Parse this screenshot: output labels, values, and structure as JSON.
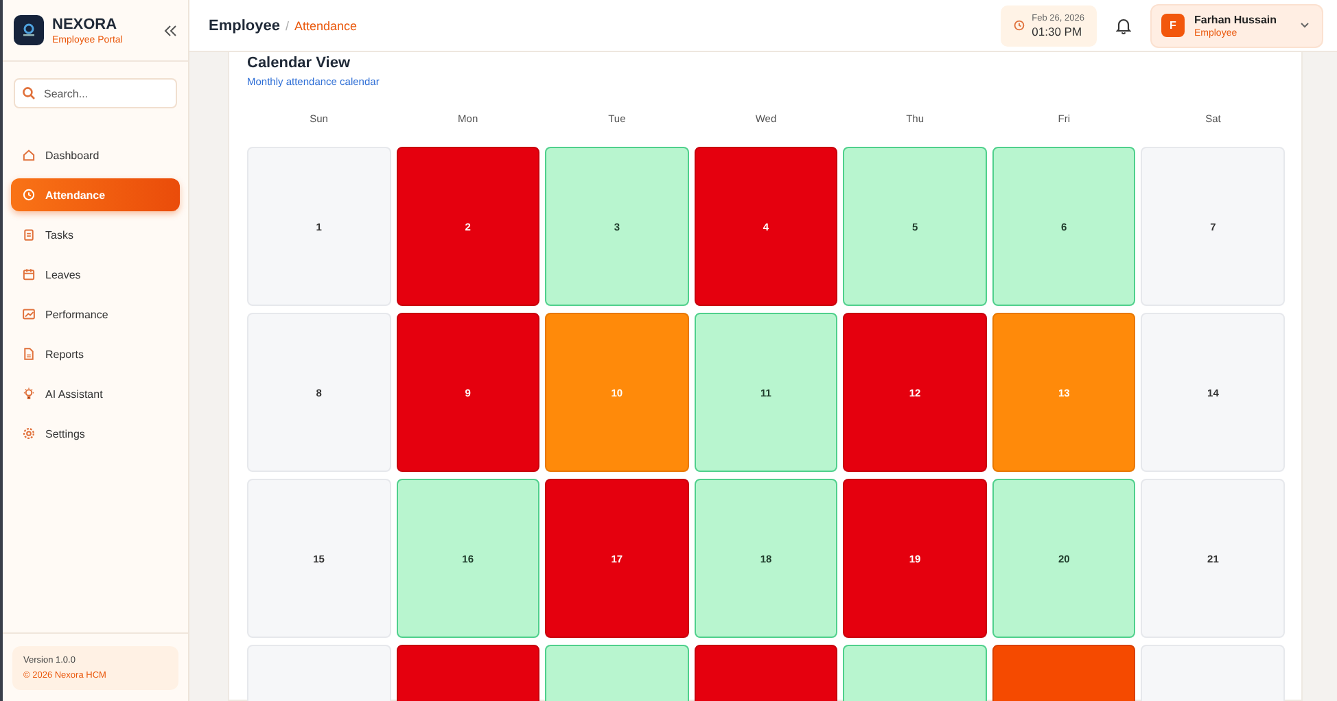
{
  "sidebar": {
    "brand": {
      "name": "NEXORA",
      "subtitle": "Employee Portal"
    },
    "search": {
      "placeholder": "Search..."
    },
    "items": [
      {
        "label": "Dashboard",
        "selected": false
      },
      {
        "label": "Attendance",
        "selected": true
      },
      {
        "label": "Tasks",
        "selected": false
      },
      {
        "label": "Leaves",
        "selected": false
      },
      {
        "label": "Performance",
        "selected": false
      },
      {
        "label": "Reports",
        "selected": false
      },
      {
        "label": "AI Assistant",
        "selected": false
      },
      {
        "label": "Settings",
        "selected": false
      }
    ],
    "footer": {
      "version": "Version 1.0.0",
      "copyright": "© 2026 Nexora HCM"
    }
  },
  "header": {
    "breadcrumb": [
      "Employee",
      "/",
      "Attendance"
    ],
    "date": "Feb 26, 2026",
    "time": "01:30 PM",
    "user": {
      "initial": "F",
      "name": "Farhan Hussain",
      "role": "Employee"
    }
  },
  "calendar": {
    "title": "Calendar View",
    "subtitle": "Monthly attendance calendar",
    "weekdays": [
      "Sun",
      "Mon",
      "Tue",
      "Wed",
      "Thu",
      "Fri",
      "Sat"
    ],
    "weeks": [
      [
        {
          "day": "1",
          "kind": "weekend"
        },
        {
          "day": "2",
          "kind": "absent"
        },
        {
          "day": "3",
          "kind": "present"
        },
        {
          "day": "4",
          "kind": "absent"
        },
        {
          "day": "5",
          "kind": "present"
        },
        {
          "day": "6",
          "kind": "present"
        },
        {
          "day": "7",
          "kind": "weekend"
        }
      ],
      [
        {
          "day": "8",
          "kind": "weekend"
        },
        {
          "day": "9",
          "kind": "absent"
        },
        {
          "day": "10",
          "kind": "late"
        },
        {
          "day": "11",
          "kind": "present"
        },
        {
          "day": "12",
          "kind": "absent"
        },
        {
          "day": "13",
          "kind": "late"
        },
        {
          "day": "14",
          "kind": "weekend"
        }
      ],
      [
        {
          "day": "15",
          "kind": "weekend"
        },
        {
          "day": "16",
          "kind": "present"
        },
        {
          "day": "17",
          "kind": "absent"
        },
        {
          "day": "18",
          "kind": "present"
        },
        {
          "day": "19",
          "kind": "absent"
        },
        {
          "day": "20",
          "kind": "present"
        },
        {
          "day": "21",
          "kind": "weekend"
        }
      ],
      [
        {
          "kind": "weekend"
        },
        {
          "kind": "absent"
        },
        {
          "kind": "present"
        },
        {
          "kind": "absent"
        },
        {
          "kind": "present"
        },
        {
          "kind": "leave"
        },
        {
          "kind": "weekend"
        }
      ]
    ]
  }
}
